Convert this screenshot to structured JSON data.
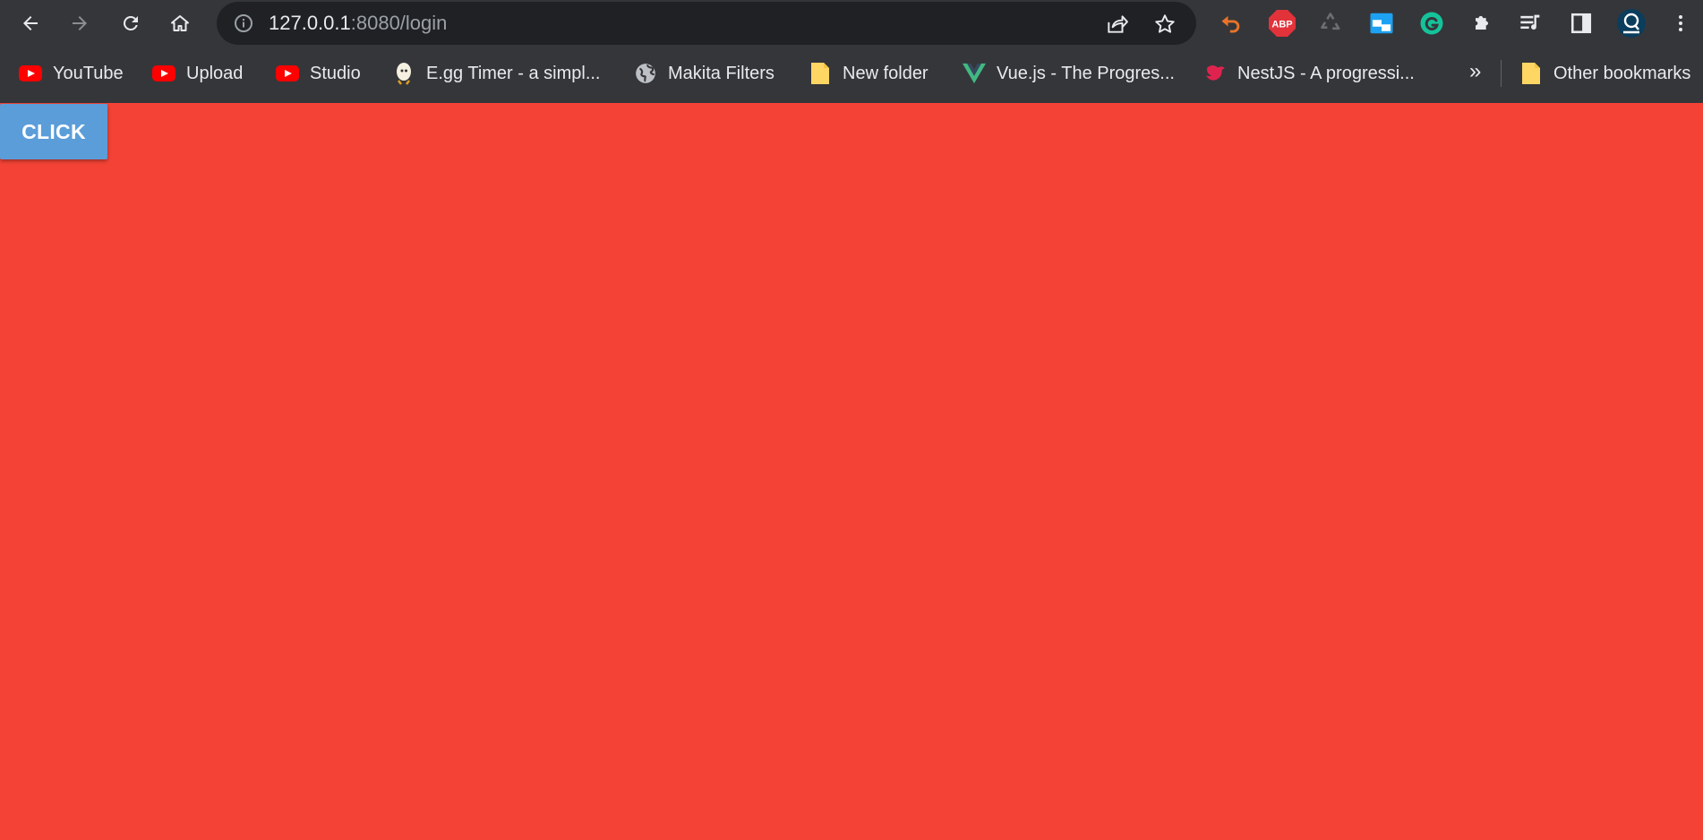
{
  "browser": {
    "address_bar": {
      "url_host": "127.0.0.1",
      "url_path": ":8080/login"
    },
    "bookmarks": [
      {
        "label": "YouTube",
        "icon": "youtube-icon"
      },
      {
        "label": "Upload",
        "icon": "youtube-icon"
      },
      {
        "label": "Studio",
        "icon": "youtube-icon"
      },
      {
        "label": "E.gg Timer - a simpl...",
        "icon": "egg-timer-icon"
      },
      {
        "label": "Makita Filters",
        "icon": "globe-icon"
      },
      {
        "label": "New folder",
        "icon": "folder-icon"
      },
      {
        "label": "Vue.js - The Progres...",
        "icon": "vue-icon"
      },
      {
        "label": "NestJS - A progressi...",
        "icon": "nestjs-icon"
      }
    ],
    "overflow_chevron": "»",
    "other_bookmarks": "Other bookmarks"
  },
  "page": {
    "background_color": "#f44336",
    "click_button_label": "CLICK",
    "click_button_color": "#5b9dd9"
  }
}
